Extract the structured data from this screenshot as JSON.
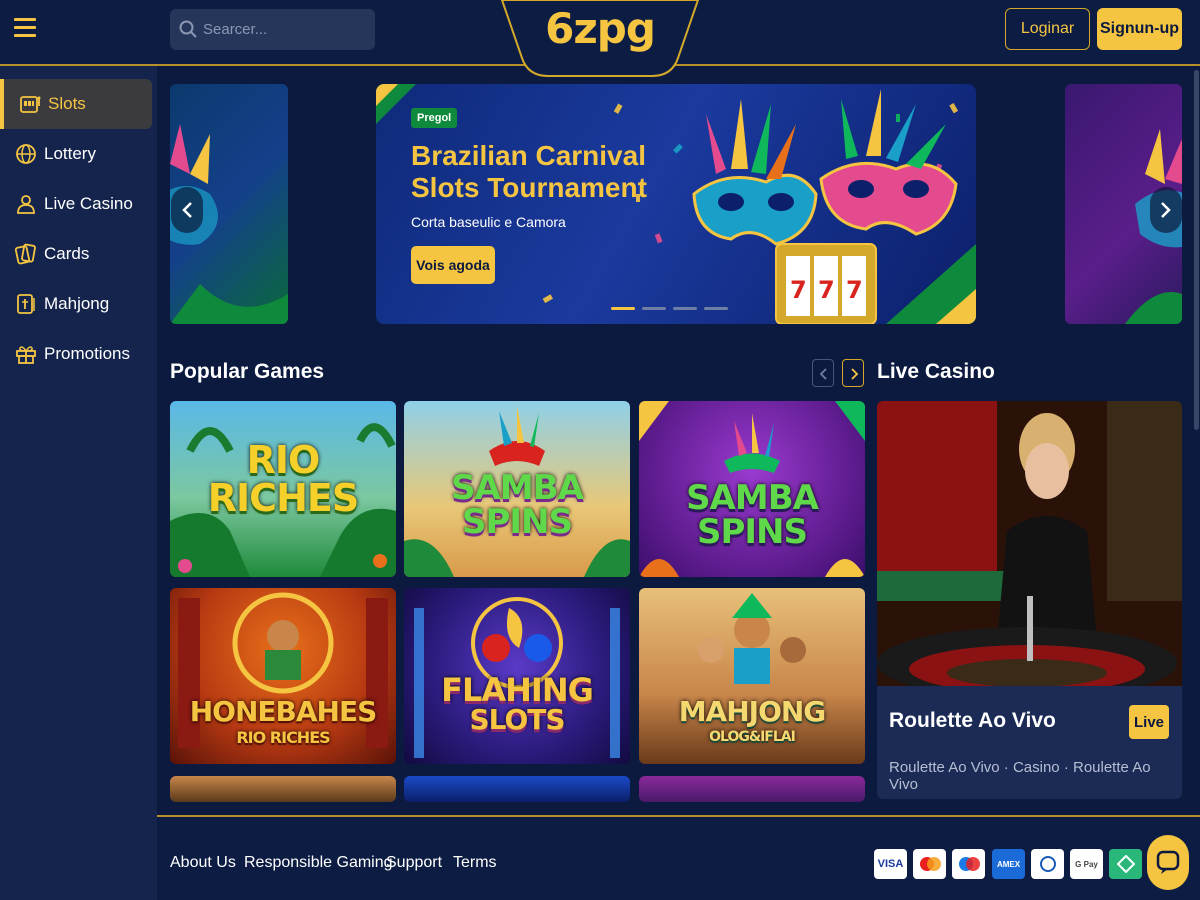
{
  "header": {
    "search_placeholder": "Searcer...",
    "logo": "6zpg",
    "login_label": "Loginar",
    "signup_label": "Signun-up"
  },
  "sidebar": {
    "items": [
      {
        "label": "Slots",
        "icon": "slot-machine-icon",
        "active": true
      },
      {
        "label": "Lottery",
        "icon": "globe-icon",
        "active": false
      },
      {
        "label": "Live Casino",
        "icon": "dealer-icon",
        "active": false
      },
      {
        "label": "Cards",
        "icon": "cards-icon",
        "active": false
      },
      {
        "label": "Mahjong",
        "icon": "mahjong-tile-icon",
        "active": false
      },
      {
        "label": "Promotions",
        "icon": "gift-icon",
        "active": false
      }
    ]
  },
  "hero": {
    "badge": "Pregol",
    "title": "Brazilian Carnival Slots Tournament",
    "subtitle": "Corta baseulic e Camora",
    "cta_label": "Vois agoda",
    "slide_count": 4,
    "active_slide": 1
  },
  "popular": {
    "title": "Popular Games",
    "games": [
      {
        "line1": "RIO",
        "line2": "RICHES",
        "theme": "jungle"
      },
      {
        "line1": "SAMBA",
        "line2": "SPINS",
        "theme": "beach"
      },
      {
        "line1": "SAMBA",
        "line2": "SPINS",
        "theme": "carnival"
      },
      {
        "line1": "HONEBAHES",
        "line2": "RIO RICHES",
        "theme": "gold"
      },
      {
        "line1": "FLAHING",
        "line2": "SLOTS",
        "theme": "neon"
      },
      {
        "line1": "MAHJONG",
        "line2": "OLOG&IFLAI",
        "theme": "temple"
      }
    ]
  },
  "live": {
    "section_title": "Live Casino",
    "card_title": "Roulette Ao Vivo",
    "badge": "Live",
    "subtitle": "Roulette Ao Vivo · Casino · Roulette Ao Vivo"
  },
  "footer": {
    "links": [
      "About Us",
      "Responsible Gaming",
      "Support",
      "Terms"
    ],
    "payments": [
      "VISA",
      "MC",
      "Maestro",
      "AMEX",
      "Diners",
      "G Pay",
      "Pix"
    ]
  },
  "colors": {
    "background": "#0b1a3e",
    "accent": "#f5c542",
    "panel": "#14244d"
  }
}
